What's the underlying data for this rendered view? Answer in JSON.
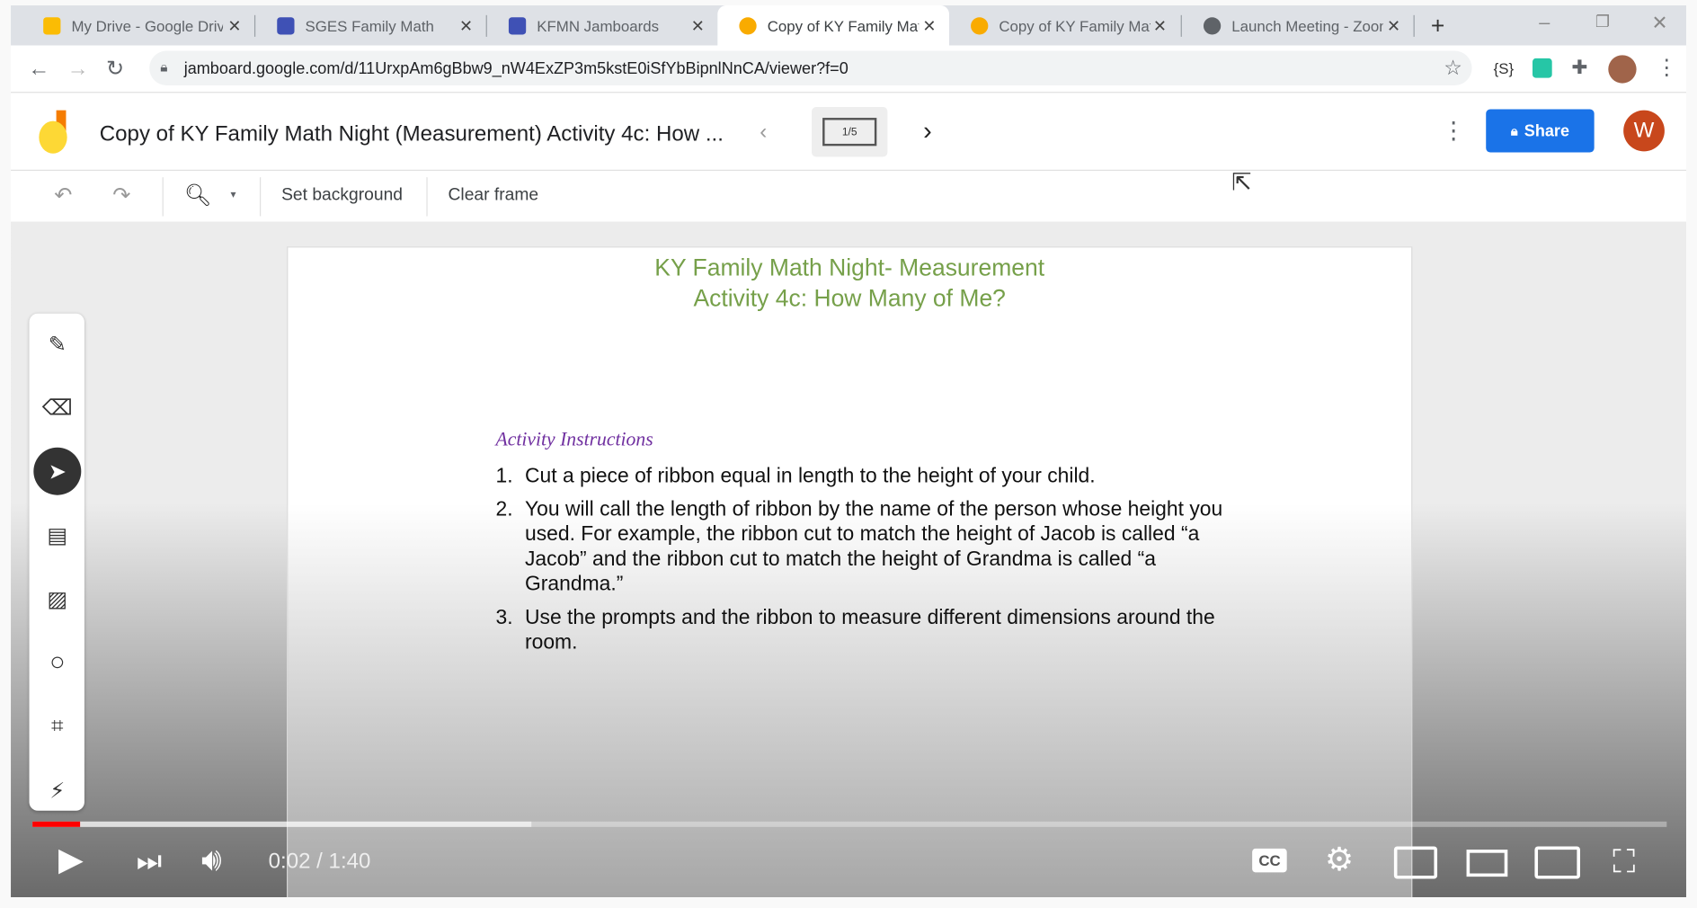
{
  "browser": {
    "tabs": [
      {
        "title": "My Drive - Google Drive",
        "color": "#fbbc04"
      },
      {
        "title": "SGES Family Math",
        "color": "#3f51b5"
      },
      {
        "title": "KFMN Jamboards",
        "color": "#3f51b5"
      },
      {
        "title": "Copy of KY Family Math Night",
        "color": "#f9ab00",
        "active": true
      },
      {
        "title": "Copy of KY Family Math Night",
        "color": "#f9ab00"
      },
      {
        "title": "Launch Meeting - Zoom",
        "color": "#5f6368"
      }
    ],
    "url": "jamboard.google.com/d/11UrxpAm6gBbw9_nW4ExZP3m5kstE0iSfYbBipnlNnCA/viewer?f=0",
    "extension_label": "{S}"
  },
  "jamboard": {
    "title": "Copy of KY Family Math Night (Measurement) Activity 4c: How ...",
    "frame_indicator": "1/5",
    "share_label": "Share",
    "avatar_initial": "W",
    "toolbar": {
      "set_background": "Set background",
      "clear_frame": "Clear frame"
    },
    "slide": {
      "heading1": "KY Family Math Night- Measurement",
      "heading2": "Activity 4c: How Many of Me?",
      "instructions_title": "Activity Instructions",
      "items": [
        {
          "n": "1.",
          "text": "Cut a piece of ribbon equal in length to the height of your child."
        },
        {
          "n": "2.",
          "text": "You will call the length of ribbon by the name of the person whose height you used. For example, the ribbon cut to match the height of Jacob is called “a Jacob” and the ribbon cut to match the height of Grandma is called “a Grandma.”"
        },
        {
          "n": "3.",
          "text": "Use the prompts and the ribbon to measure different dimensions around the room."
        }
      ]
    }
  },
  "video": {
    "time": "0:02 / 1:40",
    "played_percent": 2.9,
    "buffered_percent": 30.5,
    "accent": "#ff0000"
  }
}
